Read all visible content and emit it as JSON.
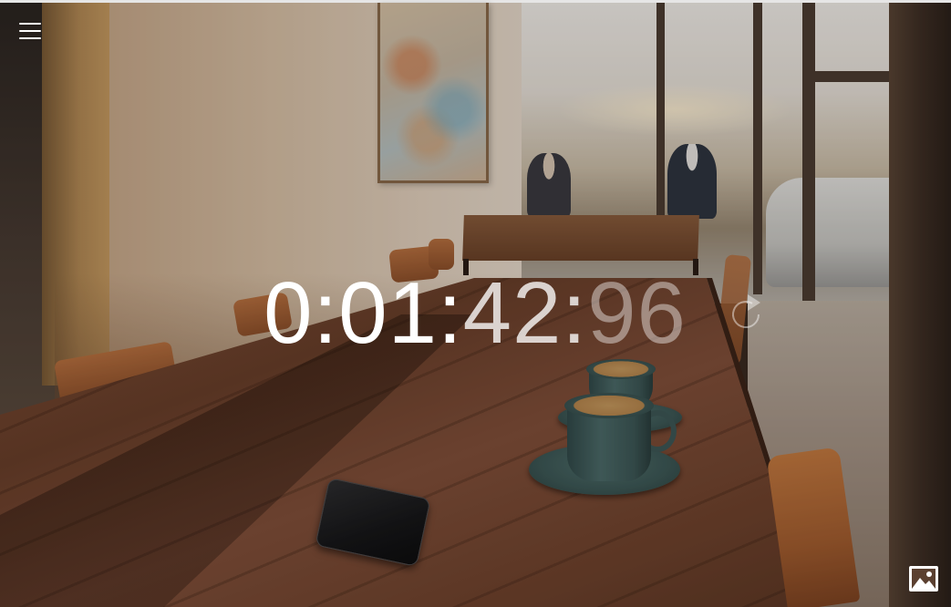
{
  "stopwatch": {
    "hours": "0",
    "minutes": "01",
    "seconds": "42",
    "centiseconds": "96",
    "separator": ":"
  },
  "icons": {
    "menu": "hamburger-menu-icon",
    "play": "play-icon",
    "reset": "reset-icon",
    "background_image": "image-icon"
  },
  "colors": {
    "text": "#ffffff"
  }
}
